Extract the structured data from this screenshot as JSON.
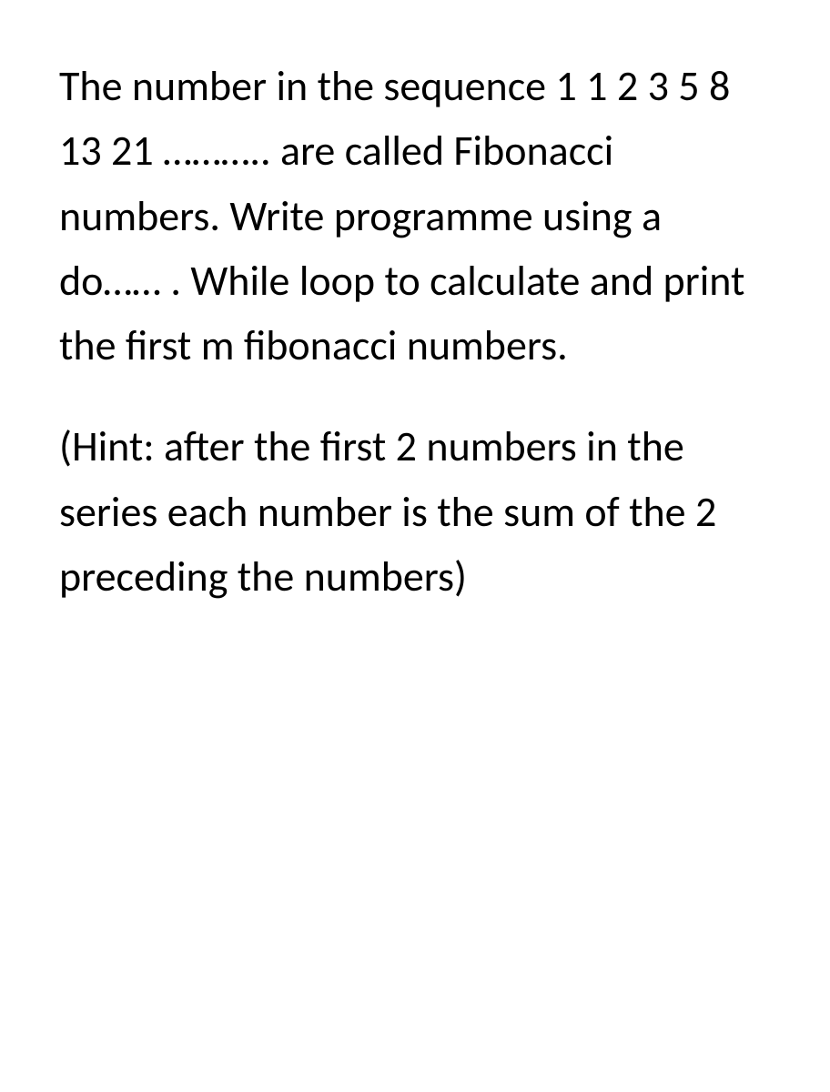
{
  "paragraph1": "The number in the sequence 1 1 2 3 5 8 13 21 ……….. are called Fibonacci numbers. Write programme using a do…… . While loop to calculate and print the first m fibonacci numbers.",
  "paragraph2": "(Hint: after the first 2 numbers in the series each number is the sum of the 2 preceding the numbers)"
}
